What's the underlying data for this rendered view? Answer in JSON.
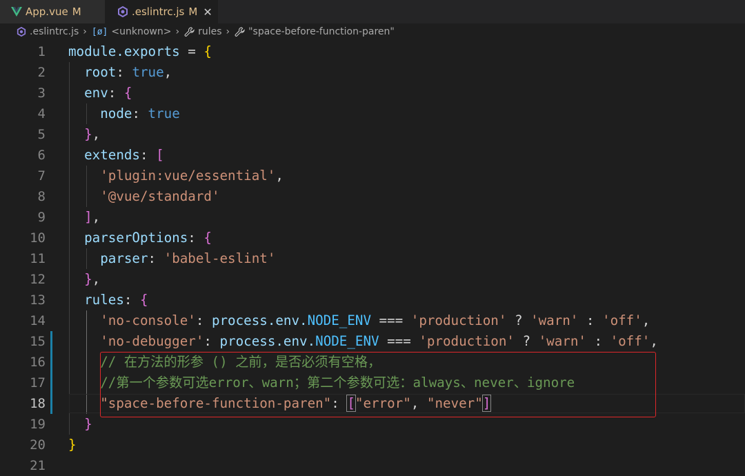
{
  "tabs": [
    {
      "label": "App.vue",
      "status": "M",
      "icon": "vue-icon"
    },
    {
      "label": ".eslintrc.js",
      "status": "M",
      "icon": "eslint-icon",
      "active": true
    }
  ],
  "breadcrumb": {
    "file": ".eslintrc.js",
    "symbol": "<unknown>",
    "rules": "rules",
    "prop": "\"space-before-function-paren\""
  },
  "editor": {
    "active_line": 18,
    "line_numbers": [
      "1",
      "2",
      "3",
      "4",
      "5",
      "6",
      "7",
      "8",
      "9",
      "10",
      "11",
      "12",
      "13",
      "14",
      "15",
      "16",
      "17",
      "18",
      "19",
      "20",
      "21"
    ],
    "tokens": {
      "l1_a": "module.exports",
      "l1_b": " = ",
      "l1_c": "{",
      "l2_a": "root",
      "l2_b": ": ",
      "l2_c": "true",
      "l2_d": ",",
      "l3_a": "env",
      "l3_b": ": ",
      "l3_c": "{",
      "l4_a": "node",
      "l4_b": ": ",
      "l4_c": "true",
      "l5_a": "}",
      "l5_b": ",",
      "l6_a": "extends",
      "l6_b": ": ",
      "l6_c": "[",
      "l7_a": "'plugin:vue/essential'",
      "l7_b": ",",
      "l8_a": "'@vue/standard'",
      "l9_a": "]",
      "l9_b": ",",
      "l10_a": "parserOptions",
      "l10_b": ": ",
      "l10_c": "{",
      "l11_a": "parser",
      "l11_b": ": ",
      "l11_c": "'babel-eslint'",
      "l12_a": "}",
      "l12_b": ",",
      "l13_a": "rules",
      "l13_b": ": ",
      "l13_c": "{",
      "l14_a": "'no-console'",
      "l14_b": ": ",
      "l14_c": "process.env.",
      "l14_d": "NODE_ENV",
      "l14_e": " === ",
      "l14_f": "'production'",
      "l14_g": " ? ",
      "l14_h": "'warn'",
      "l14_i": " : ",
      "l14_j": "'off'",
      "l14_k": ",",
      "l15_a": "'no-debugger'",
      "l15_b": ": ",
      "l15_c": "process.env.",
      "l15_d": "NODE_ENV",
      "l15_e": " === ",
      "l15_f": "'production'",
      "l15_g": " ? ",
      "l15_h": "'warn'",
      "l15_i": " : ",
      "l15_j": "'off'",
      "l15_k": ",",
      "l16_a": "// 在方法的形参 () 之前，是否必须有空格，",
      "l17_a": "//第一个参数可选error、warn；第二个参数可选：always、never、ignore",
      "l18_a": "\"space-before-function-paren\"",
      "l18_b": ": ",
      "l18_c": "[",
      "l18_d": "\"error\"",
      "l18_e": ", ",
      "l18_f": "\"never\"",
      "l18_g": "]",
      "l19_a": "}",
      "l20_a": "}"
    }
  },
  "colors": {
    "background": "#1e1e1e",
    "property": "#9cdcfe",
    "string": "#ce9178",
    "keyword_bool": "#569cd6",
    "comment": "#6a9955",
    "annotation_box": "#e0282a"
  }
}
